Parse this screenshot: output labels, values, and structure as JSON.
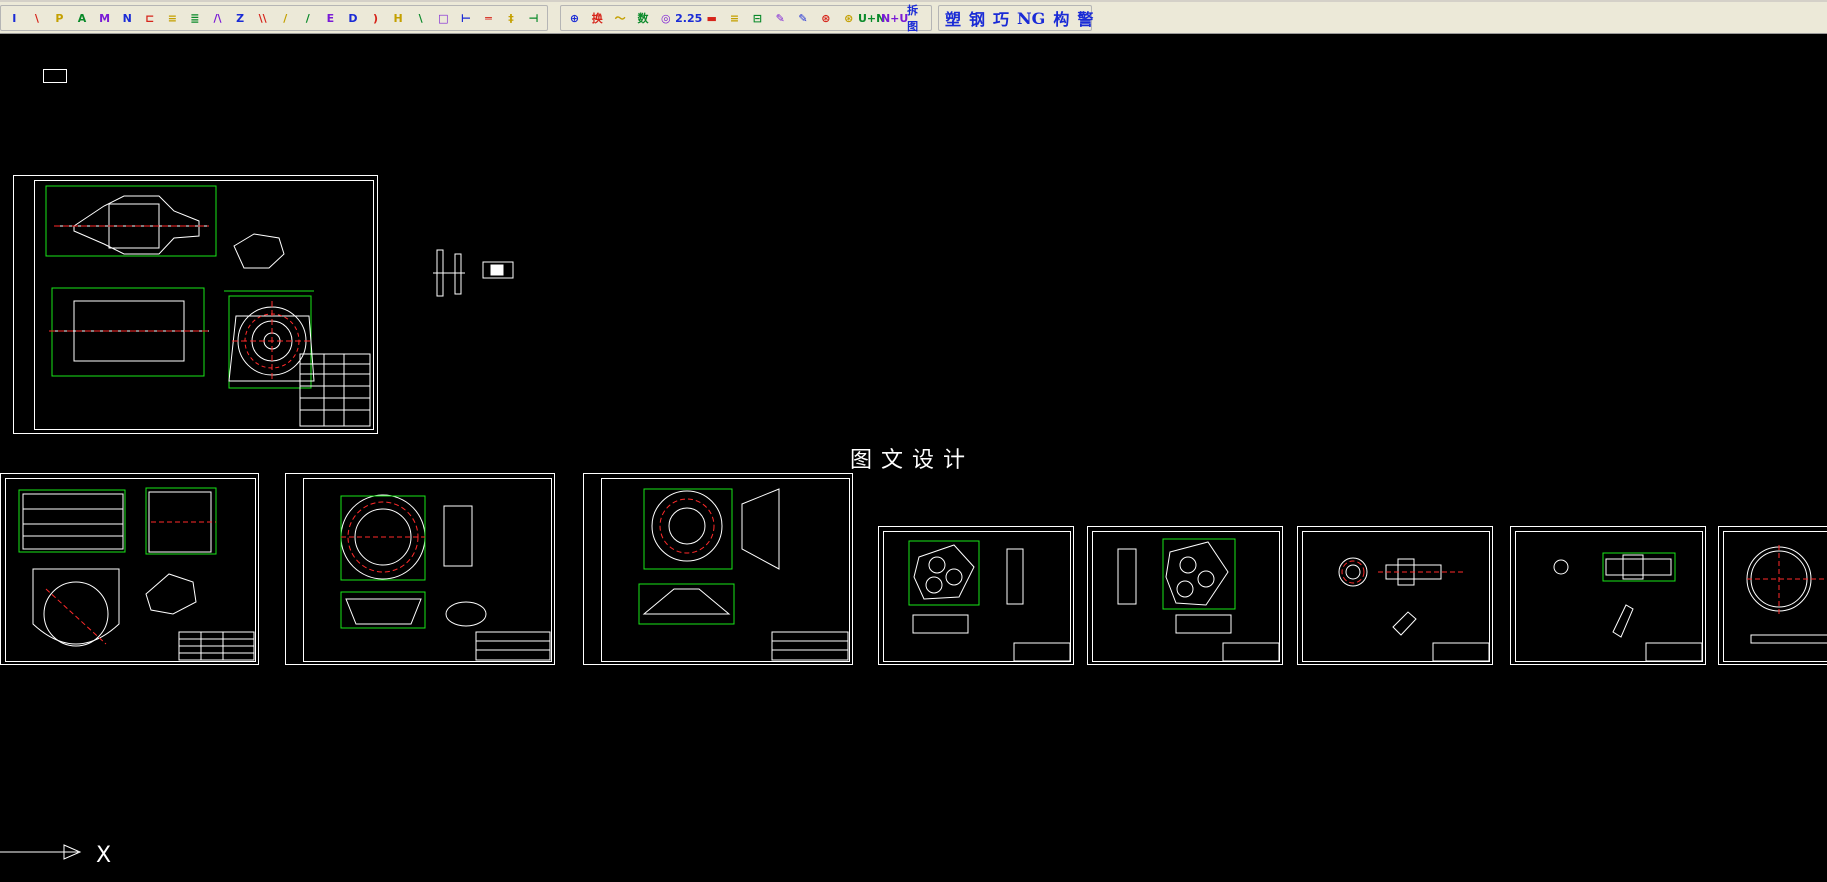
{
  "toolbar": {
    "left_tools": [
      "I",
      "\\",
      "P",
      "A",
      "M",
      "N",
      "⊏",
      "≡",
      "≣",
      "/\\",
      "Z",
      "\\\\",
      "/",
      "/",
      "E",
      "D",
      ")",
      "H",
      "\\",
      "□",
      "⊢",
      "═",
      "‡",
      "⊣"
    ],
    "right_tools": [
      "⊕",
      "换",
      "〜",
      "数",
      "◎",
      "2.25",
      "▬",
      "≡",
      "⊟",
      "✎",
      "✎",
      "⊛",
      "⊛",
      "U+N",
      "N+U",
      "拆图"
    ],
    "text_buttons": [
      "塑",
      "钢",
      "巧",
      "NG",
      "构",
      "警"
    ]
  },
  "canvas": {
    "watermark_text": "图文设计",
    "axis_label": "X"
  },
  "colors": {
    "background": "#000000",
    "lines": "#ffffff",
    "green": "#19e619",
    "red": "#ff2a2a",
    "accent_blue": "#1a2bd6"
  }
}
